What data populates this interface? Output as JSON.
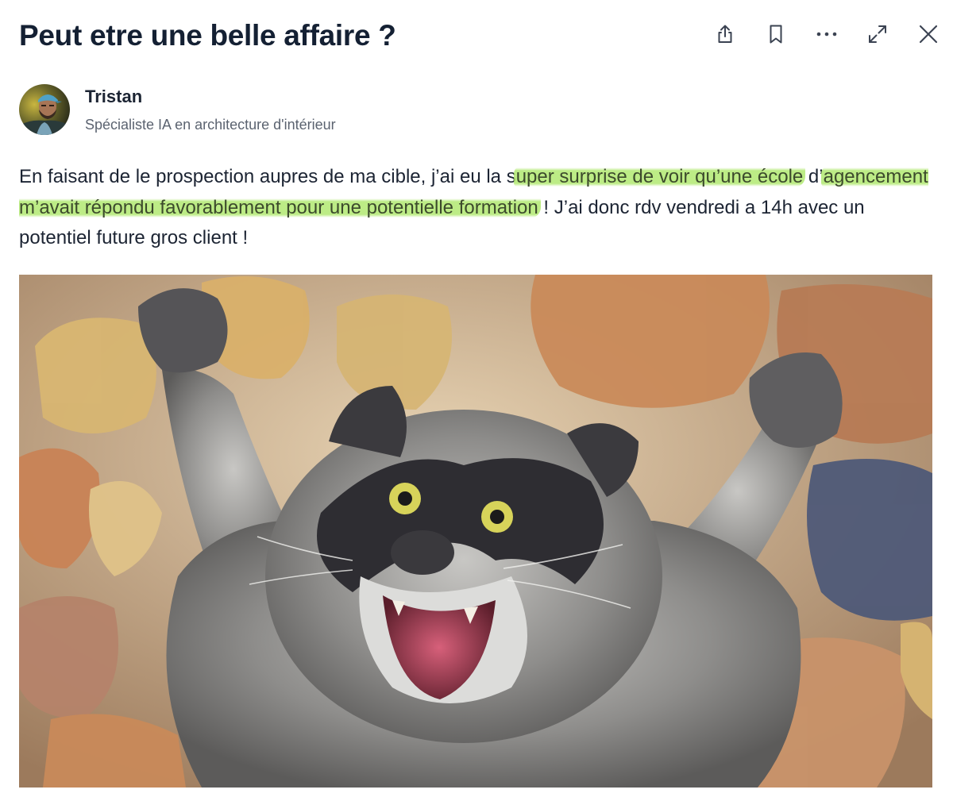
{
  "post": {
    "title": "Peut etre une belle affaire ?",
    "author": {
      "name": "Tristan",
      "role": "Spécialiste IA en architecture d'intérieur",
      "avatar_icon": "person-avatar"
    },
    "body": {
      "part1": "En faisant de le prospection aupres de ma cible, j’ai eu la s",
      "highlight1": "uper surprise de voir qu’une école",
      "part2": " d’",
      "highlight2": "agencement m’avait répondu favorablement pour une potentielle formation",
      "part3": " ! J’ai donc rdv vendredi a 14h avec un potentiel future gros client !"
    },
    "highlight_color": "#b7ec7a",
    "image": {
      "subject": "excited-raccoon-gif"
    }
  },
  "toolbar": {
    "share_icon": "share-icon",
    "bookmark_icon": "bookmark-icon",
    "more_icon": "more-horizontal-icon",
    "expand_icon": "expand-icon",
    "close_icon": "close-icon"
  },
  "colors": {
    "title": "#142033",
    "text": "#1c2433",
    "muted": "#5b6370",
    "icon": "#3b4352"
  }
}
